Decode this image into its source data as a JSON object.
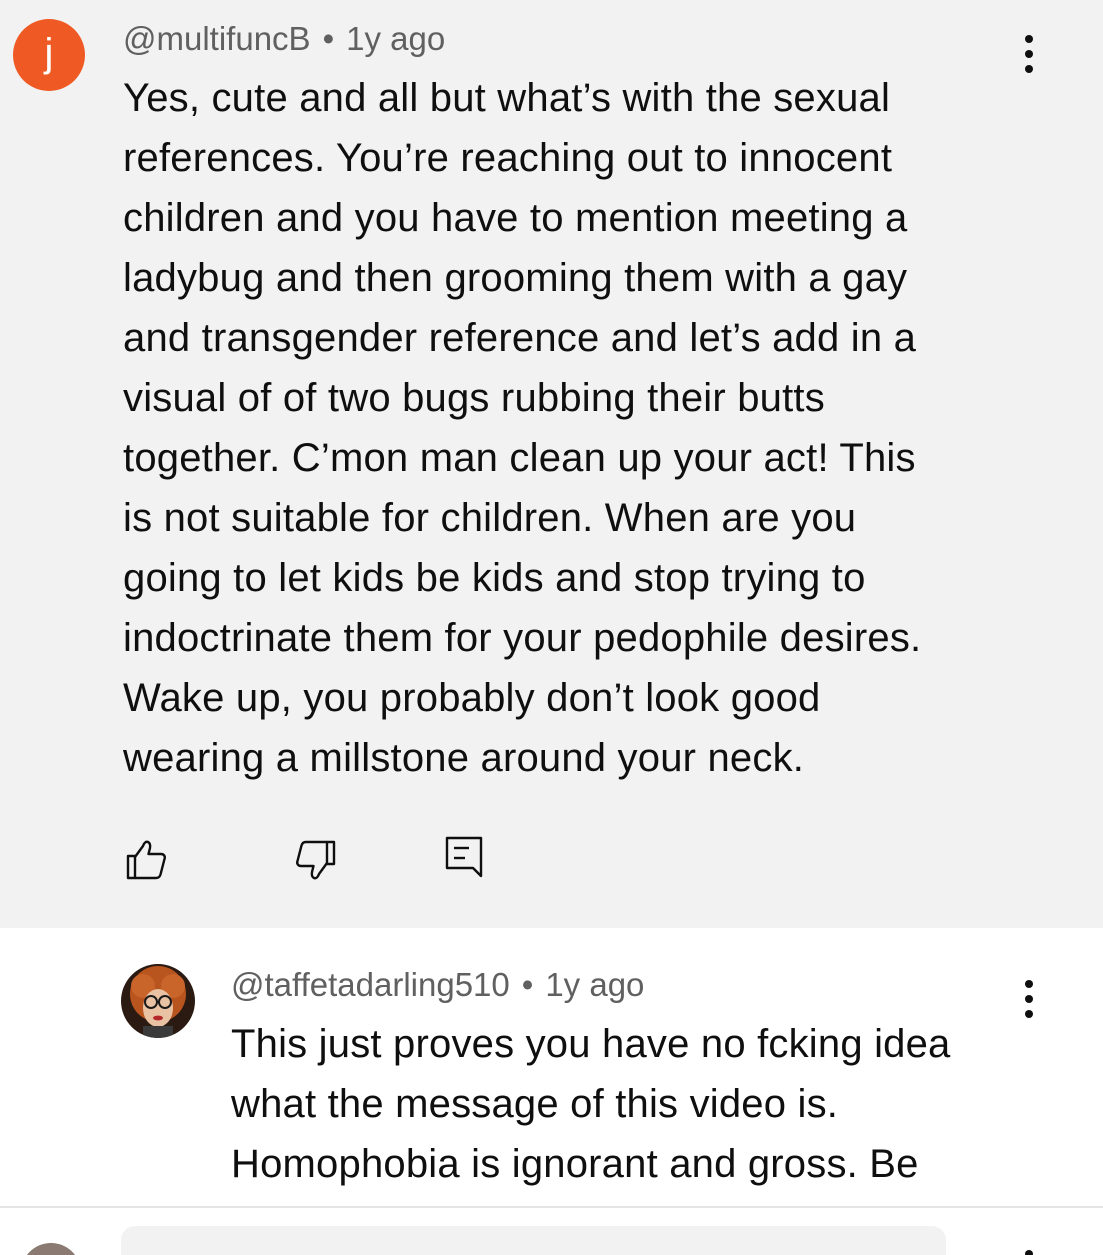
{
  "comment": {
    "avatar_letter": "j",
    "avatar_color": "#ef5a24",
    "author": "@multifuncB",
    "separator": "•",
    "timestamp": "1y ago",
    "body_lines": [
      "Yes, cute and all but what’s with the sexual",
      "references. You’re reaching out to innocent",
      "children and you have to mention meeting a",
      "ladybug and then grooming them with a gay",
      "and transgender reference and let’s add in a",
      "visual of of two bugs rubbing their butts",
      "together. C’mon man clean up your act! This",
      "is not suitable for children. When are you",
      "going to let kids be kids and stop trying to",
      "indoctrinate them for your pedophile desires.",
      "Wake up, you probably don’t look good",
      "wearing a millstone around your neck."
    ],
    "actions": {
      "like_icon": "thumbs-up-icon",
      "dislike_icon": "thumbs-down-icon",
      "reply_icon": "reply-comment-icon",
      "menu_icon": "more-vert-icon"
    }
  },
  "reply": {
    "author": "@taffetadarling510",
    "separator": "•",
    "timestamp": "1y ago",
    "body_lines": [
      "This just proves you have no fcking idea",
      "what the message of this video is.",
      "Homophobia is ignorant and gross. Be"
    ],
    "menu_icon": "more-vert-icon"
  },
  "colors": {
    "highlight_background": "#f2f2f2",
    "meta_text": "#606060",
    "body_text": "#0f0f0f"
  }
}
